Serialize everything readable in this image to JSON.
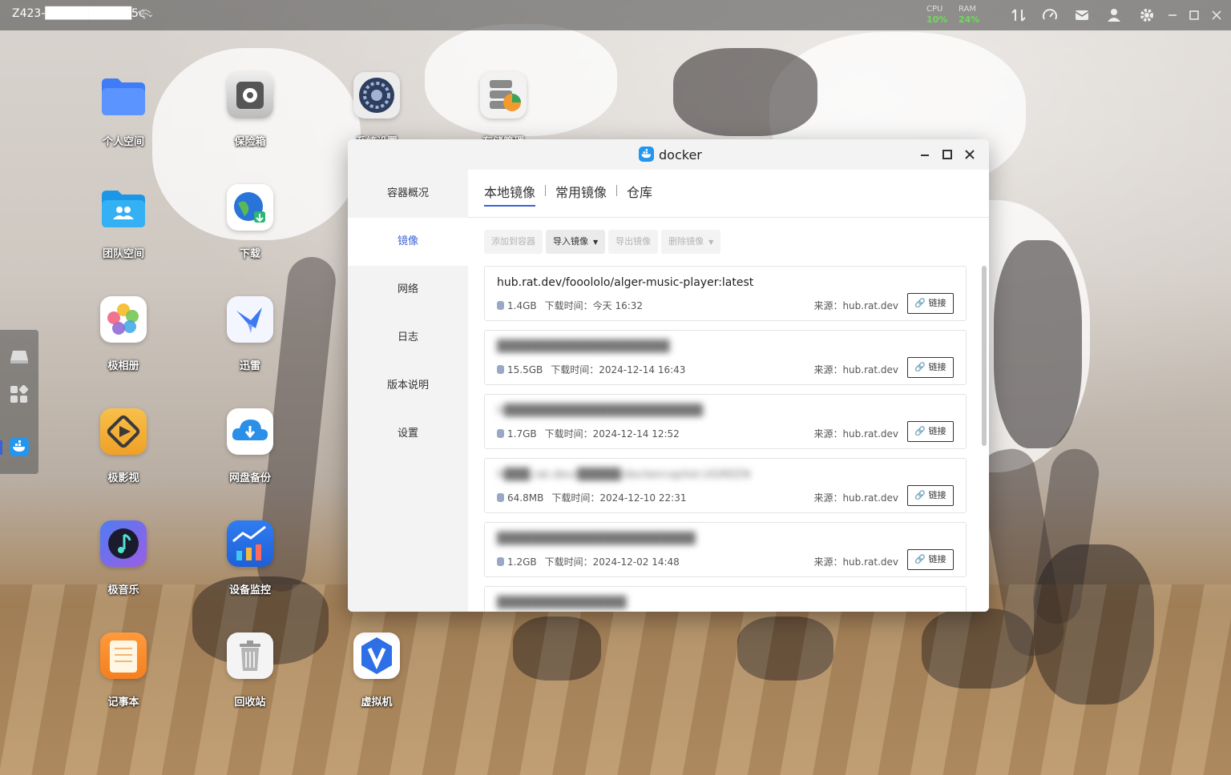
{
  "topbar": {
    "device_name": "Z423-██████████5c",
    "chevron": "⌄",
    "cpu_label": "CPU",
    "cpu_value": "10%",
    "ram_label": "RAM",
    "ram_value": "24%",
    "icons": [
      "transfer-icon",
      "speedometer-icon",
      "mail-icon",
      "user-icon",
      "gear-icon",
      "restore-icon",
      "maximize-icon",
      "close-icon"
    ]
  },
  "desktop": {
    "icons": [
      {
        "label": "个人空间",
        "icon": "folder-icon"
      },
      {
        "label": "保险箱",
        "icon": "safe-icon"
      },
      {
        "label": "系统设置",
        "icon": "settings-icon"
      },
      {
        "label": "存储管理",
        "icon": "storage-icon"
      },
      {
        "label": "团队空间",
        "icon": "team-folder-icon"
      },
      {
        "label": "下载",
        "icon": "download-globe-icon"
      },
      {
        "label": "极相册",
        "icon": "photos-icon"
      },
      {
        "label": "迅雷",
        "icon": "thunder-bird-icon"
      },
      {
        "label": "极影视",
        "icon": "video-icon"
      },
      {
        "label": "网盘备份",
        "icon": "cloud-backup-icon"
      },
      {
        "label": "极音乐",
        "icon": "music-icon"
      },
      {
        "label": "设备监控",
        "icon": "monitor-chart-icon"
      },
      {
        "label": "记事本",
        "icon": "notepad-icon"
      },
      {
        "label": "回收站",
        "icon": "trash-icon"
      },
      {
        "label": "虚拟机",
        "icon": "vm-icon"
      }
    ]
  },
  "dock": {
    "icons": [
      "drive-icon",
      "apps-grid-icon",
      "docker-icon"
    ]
  },
  "window": {
    "title": "docker",
    "sidebar": [
      "容器概况",
      "镜像",
      "网络",
      "日志",
      "版本说明",
      "设置"
    ],
    "active_sidebar": "镜像",
    "tabs": [
      "本地镜像",
      "常用镜像",
      "仓库"
    ],
    "active_tab": "本地镜像",
    "toolbar": {
      "add_to_container": "添加到容器",
      "import_image": "导入镜像",
      "export_image": "导出镜像",
      "delete_image": "删除镜像"
    },
    "images": [
      {
        "name": "hub.rat.dev/fooololo/alger-music-player:latest",
        "blurred": false,
        "size": "1.4GB",
        "time_label": "下载时间：",
        "time": "今天 16:32",
        "source": "来源：hub.rat.dev",
        "link_label": "链接"
      },
      {
        "name": "████████████████████",
        "blurred": true,
        "size": "15.5GB",
        "time_label": "下载时间：",
        "time": "2024-12-14 16:43",
        "source": "来源：hub.rat.dev",
        "link_label": "链接"
      },
      {
        "name": "h███████████████████████:",
        "blurred": true,
        "size": "1.7GB",
        "time_label": "下载时间：",
        "time": "2024-12-14 12:52",
        "source": "来源：hub.rat.dev",
        "link_label": "链接"
      },
      {
        "name": "h███.rat.dev/█████/dockercopilot:UGREEN",
        "blurred": true,
        "size": "64.8MB",
        "time_label": "下载时间：",
        "time": "2024-12-10 22:31",
        "source": "来源：hub.rat.dev",
        "link_label": "链接"
      },
      {
        "name": "███████████████████████",
        "blurred": true,
        "size": "1.2GB",
        "time_label": "下载时间：",
        "time": "2024-12-02 14:48",
        "source": "来源：hub.rat.dev",
        "link_label": "链接"
      },
      {
        "name": "███████████████",
        "blurred": true,
        "size": "",
        "time_label": "",
        "time": "",
        "source": "",
        "link_label": ""
      }
    ]
  },
  "colors": {
    "accent": "#3a62d7",
    "docker_blue": "#2496ed",
    "stat_green": "#6ddb5a"
  }
}
